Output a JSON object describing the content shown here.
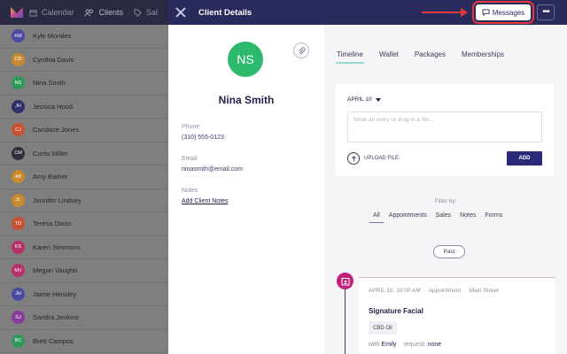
{
  "background_app": {
    "nav": [
      {
        "label": "Calendar",
        "icon": "calendar-icon"
      },
      {
        "label": "Clients",
        "icon": "users-icon"
      },
      {
        "label": "Sal",
        "icon": "tag-icon"
      }
    ],
    "clients": [
      {
        "initials": "KM",
        "name": "Kyle Morales",
        "color": "#4a4aa0"
      },
      {
        "initials": "CD",
        "name": "Cynthia Davis",
        "color": "#c98a2e"
      },
      {
        "initials": "NS",
        "name": "Nina Smith",
        "color": "#2e9a5a"
      },
      {
        "initials": "JH",
        "name": "Jessica Hood",
        "color": "#2e2e6a"
      },
      {
        "initials": "CJ",
        "name": "Candace Jones",
        "color": "#c9502e"
      },
      {
        "initials": "CM",
        "name": "Curtis Miller",
        "color": "#2e2e3e"
      },
      {
        "initials": "AB",
        "name": "Amy Barker",
        "color": "#c98a2e"
      },
      {
        "initials": "JL",
        "name": "Jennifer Lindsey",
        "color": "#c98a2e"
      },
      {
        "initials": "TD",
        "name": "Teresa Dixon",
        "color": "#c9502e"
      },
      {
        "initials": "KS",
        "name": "Karen Simmons",
        "color": "#b8306a"
      },
      {
        "initials": "MV",
        "name": "Megan Vaughn",
        "color": "#b8306a"
      },
      {
        "initials": "JH",
        "name": "Jaime Hensley",
        "color": "#4a4aa0"
      },
      {
        "initials": "SJ",
        "name": "Sandra Jenkins",
        "color": "#8a3a9a"
      },
      {
        "initials": "BC",
        "name": "Brett Campos",
        "color": "#2e9a5a"
      }
    ]
  },
  "panel": {
    "title": "Client Details",
    "messages_label": "Messages",
    "more_label": "•••"
  },
  "profile": {
    "initials": "NS",
    "name": "Nina Smith",
    "phone_label": "Phone",
    "phone": "(310) 555-0123",
    "email_label": "Email",
    "email": "ninasmith@email.com",
    "notes_label": "Notes",
    "notes_link": "Add Client Notes"
  },
  "tabs": [
    "Timeline",
    "Wallet",
    "Packages",
    "Memberships"
  ],
  "entry": {
    "date": "APRIL 10",
    "placeholder": "Write an entry or drag in a file...",
    "upload_label": "UPLOAD FILE",
    "add_label": "ADD"
  },
  "filter": {
    "label": "Filter by:",
    "options": [
      "All",
      "Appointments",
      "Sales",
      "Notes",
      "Forms"
    ]
  },
  "past_label": "Past",
  "appointment": {
    "date": "APRIL 10, 10:00 AM",
    "type": "Appointment",
    "location": "Main Street",
    "title": "Signature Facial",
    "addon": "CBD Oil",
    "with_label": "with",
    "staff": "Emily",
    "request_label": "request:",
    "request": "none"
  },
  "colors": {
    "header": "#2b2a5c",
    "avatar": "#2eba6e",
    "highlight": "#e03a3a",
    "timeline_dot": "#c2207a"
  }
}
